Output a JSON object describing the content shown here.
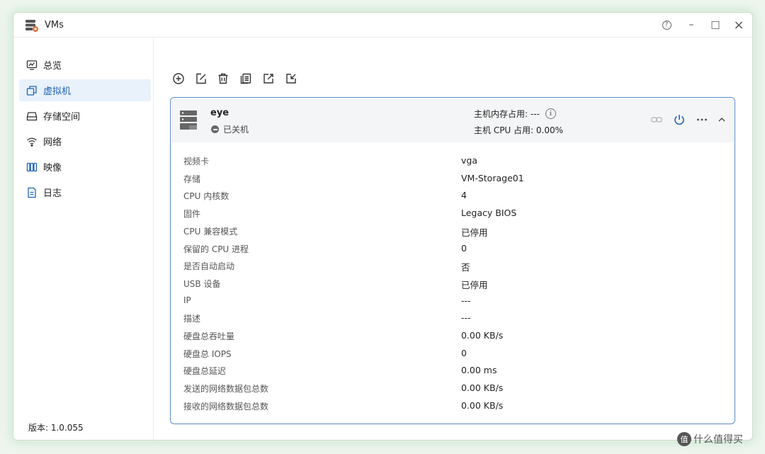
{
  "window": {
    "title": "VMs",
    "controls": [
      "?",
      "–",
      "□",
      "×"
    ]
  },
  "sidebar": {
    "items": [
      {
        "label": "总览",
        "icon": "overview-icon"
      },
      {
        "label": "虚拟机",
        "icon": "vm-icon",
        "active": true
      },
      {
        "label": "存储空间",
        "icon": "storage-icon"
      },
      {
        "label": "网络",
        "icon": "wifi-icon"
      },
      {
        "label": "映像",
        "icon": "image-icon"
      },
      {
        "label": "日志",
        "icon": "log-icon"
      }
    ],
    "version": "版本: 1.0.055"
  },
  "toolbar": {
    "buttons": [
      "add-icon",
      "edit-icon",
      "delete-icon",
      "clone-icon",
      "export-icon",
      "import-icon"
    ]
  },
  "vm": {
    "name": "eye",
    "status": "已关机",
    "memory_usage": "主机内存占用: ---",
    "cpu_usage": "主机 CPU 占用: 0.00%",
    "details": [
      {
        "key": "视频卡",
        "value": "vga"
      },
      {
        "key": "存储",
        "value": "VM-Storage01"
      },
      {
        "key": "CPU 内核数",
        "value": "4"
      },
      {
        "key": "固件",
        "value": "Legacy BIOS"
      },
      {
        "key": "CPU 兼容模式",
        "value": "已停用"
      },
      {
        "key": "保留的 CPU 进程",
        "value": "0"
      },
      {
        "key": "是否自动启动",
        "value": "否"
      },
      {
        "key": "USB 设备",
        "value": "已停用"
      },
      {
        "key": "IP",
        "value": "---"
      },
      {
        "key": "描述",
        "value": "---"
      },
      {
        "key": "硬盘总吞吐量",
        "value": "0.00 KB/s"
      },
      {
        "key": "硬盘总 IOPS",
        "value": "0"
      },
      {
        "key": "硬盘总延迟",
        "value": "0.00 ms"
      },
      {
        "key": "发送的网络数据包总数",
        "value": "0.00 KB/s"
      },
      {
        "key": "接收的网络数据包总数",
        "value": "0.00 KB/s"
      }
    ]
  },
  "watermark": {
    "logo_text": "值",
    "text": "什么值得买"
  },
  "colors": {
    "accent": "#1f63b7",
    "card_border": "#5d8fd3",
    "power": "#1f63b7"
  }
}
